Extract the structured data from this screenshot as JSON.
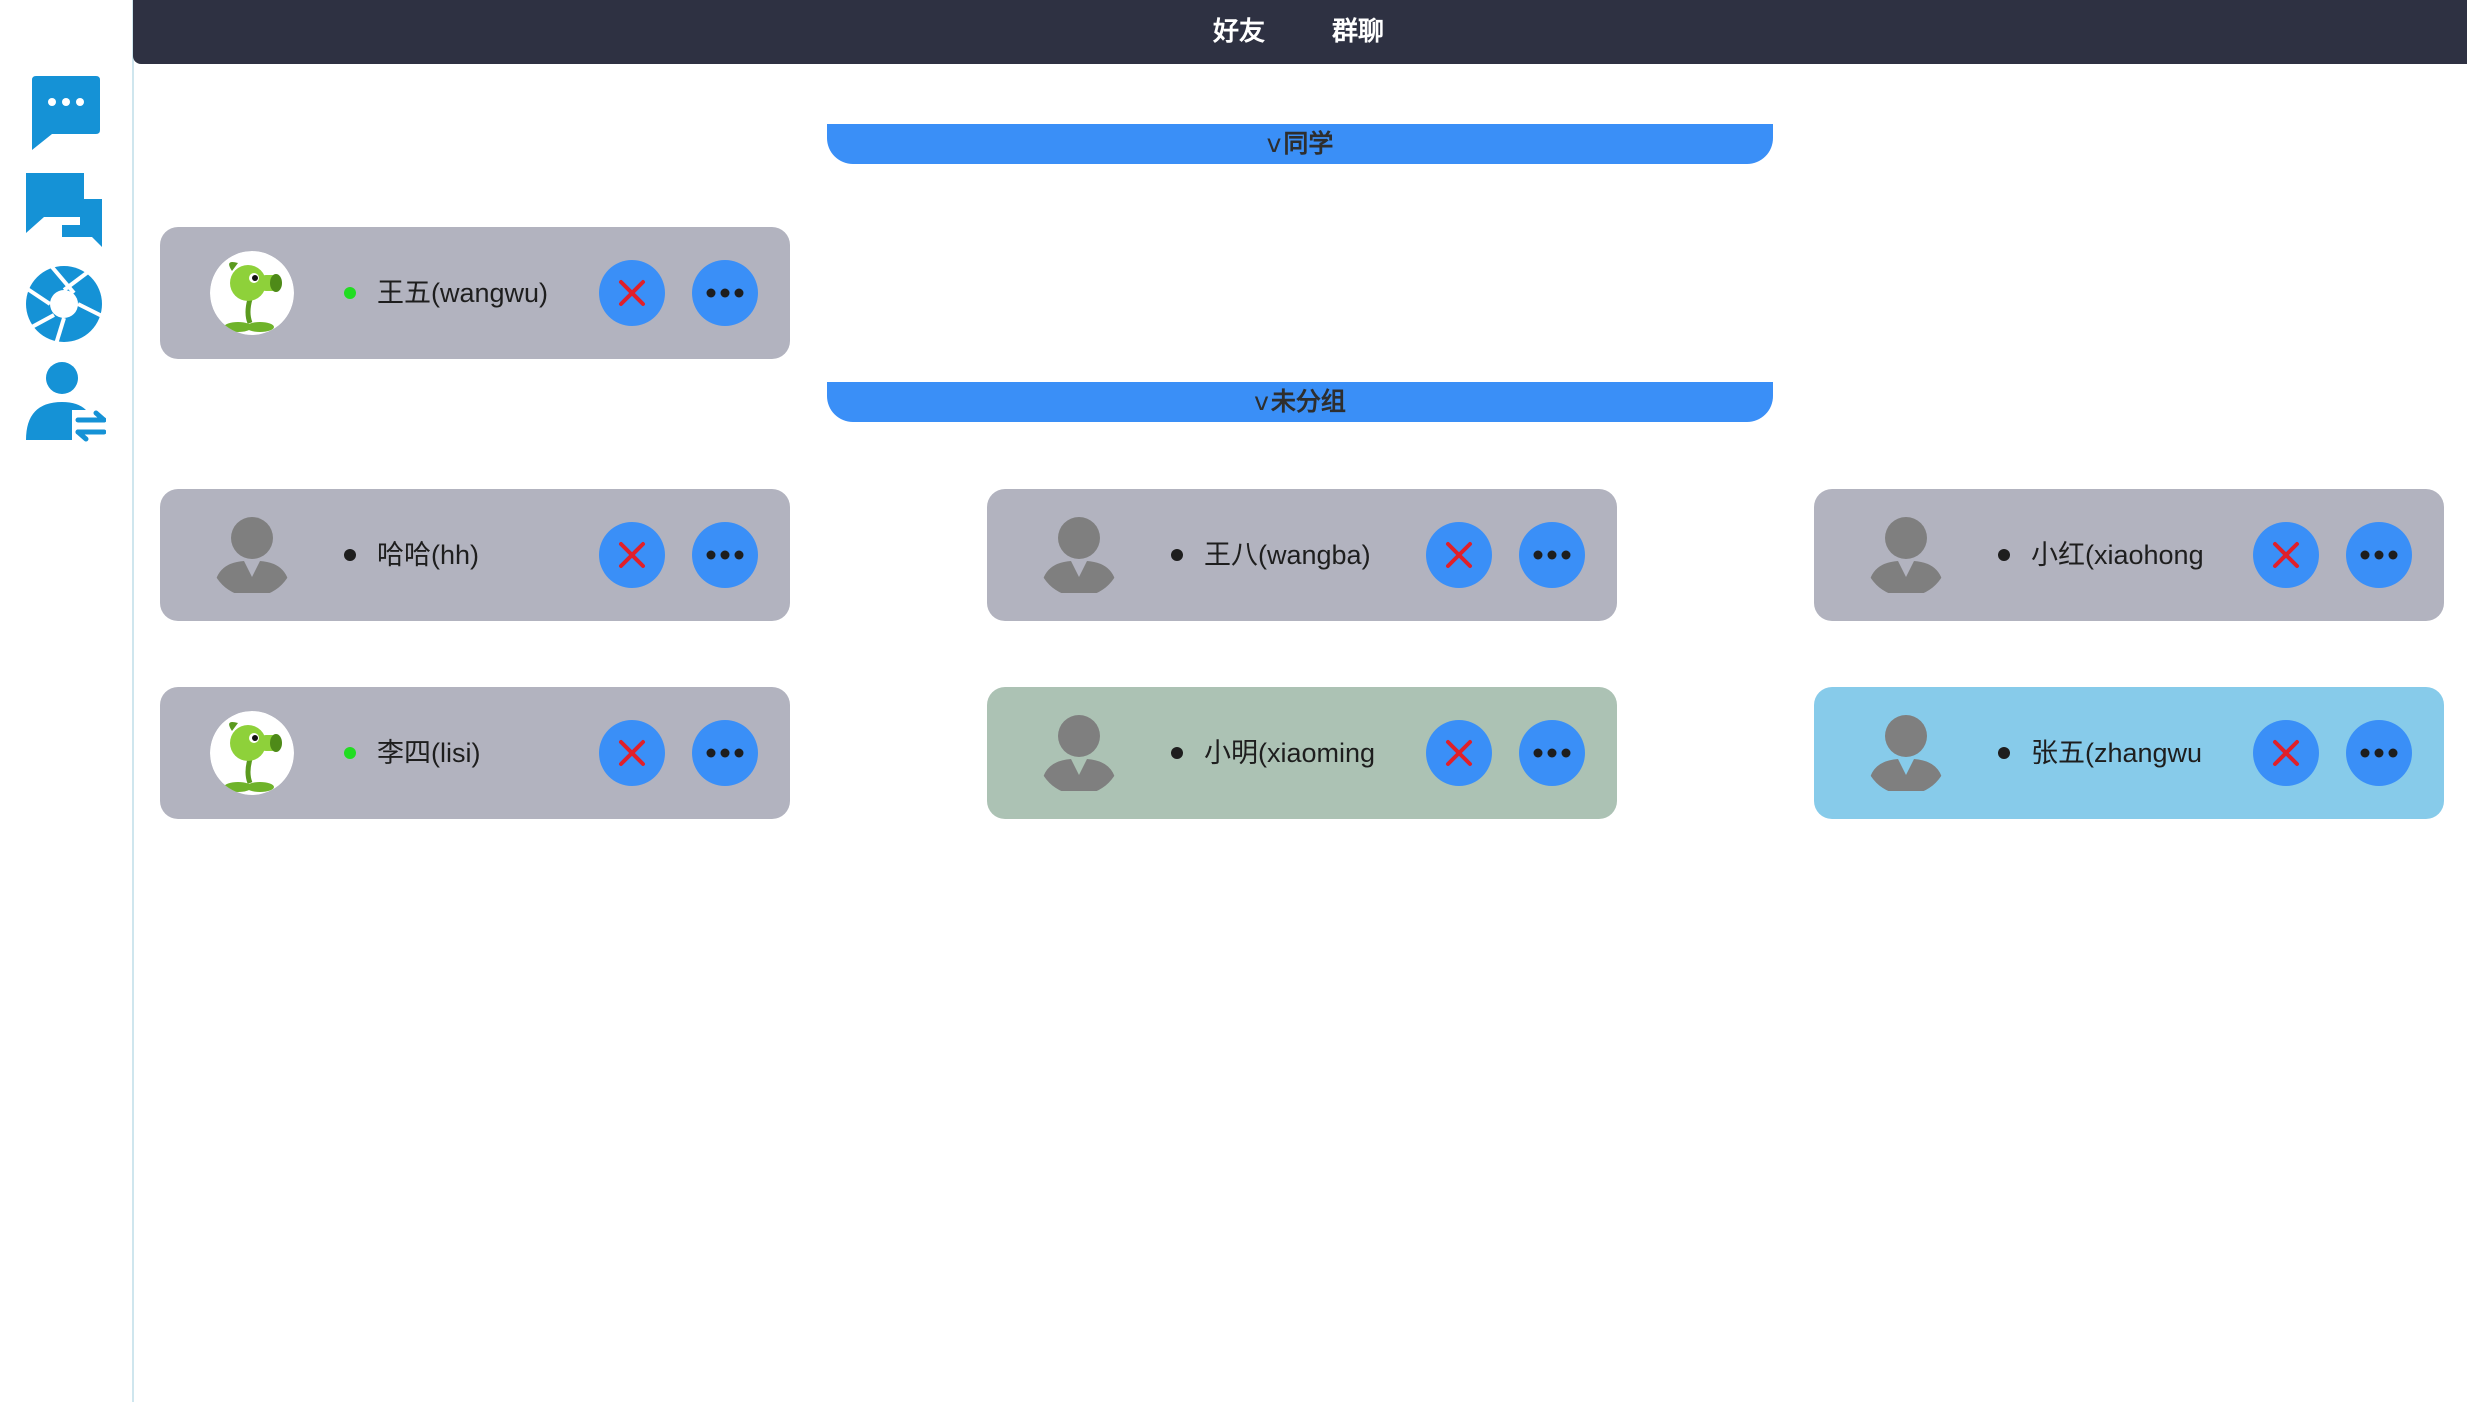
{
  "tabs": {
    "friends": "好友",
    "group_chat": "群聊"
  },
  "sidebar": {
    "items": [
      {
        "icon": "chat-bubble-icon"
      },
      {
        "icon": "conversations-icon"
      },
      {
        "icon": "aperture-icon"
      },
      {
        "icon": "user-switch-icon"
      }
    ]
  },
  "groups": [
    {
      "caret": "v",
      "title": "同学",
      "friends": [
        {
          "name": "王五(wangwu)",
          "avatar": "peashooter",
          "online": true,
          "card_color": "gray"
        }
      ]
    },
    {
      "caret": "v",
      "title": "未分组",
      "friends": [
        {
          "name": "哈哈(hh)",
          "avatar": "default",
          "online": false,
          "card_color": "gray"
        },
        {
          "name": "王八(wangba)",
          "avatar": "default",
          "online": false,
          "card_color": "gray"
        },
        {
          "name": "小红(xiaohong",
          "avatar": "default",
          "online": false,
          "card_color": "gray"
        },
        {
          "name": "李四(lisi)",
          "avatar": "peashooter",
          "online": true,
          "card_color": "gray"
        },
        {
          "name": "小明(xiaoming",
          "avatar": "default",
          "online": false,
          "card_color": "green"
        },
        {
          "name": "张五(zhangwu",
          "avatar": "default",
          "online": false,
          "card_color": "blue"
        }
      ]
    }
  ],
  "colors": {
    "accent": "#3a8ff7",
    "topbar": "#2e3142",
    "card_gray": "#b2b3bf",
    "card_green": "#acc2b4",
    "card_blue": "#87cbea",
    "online": "#22dd22",
    "offline": "#1e1e1e",
    "delete_x": "#e0202a",
    "rail_icon": "#1592d6"
  }
}
